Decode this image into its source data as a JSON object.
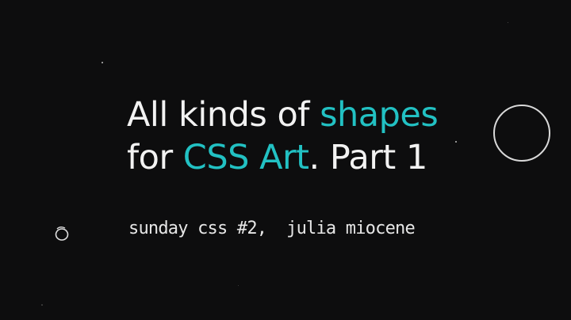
{
  "title": {
    "line1": {
      "part1": "All kinds of ",
      "part2": "shapes"
    },
    "line2": {
      "part1": "for ",
      "part2": "CSS Art",
      "part3": ". Part 1"
    }
  },
  "subtitle": "sunday css #2,  julia miocene",
  "colors": {
    "background": "#0d0d0e",
    "text": "#f2f2f2",
    "accent": "#22c1c3"
  }
}
